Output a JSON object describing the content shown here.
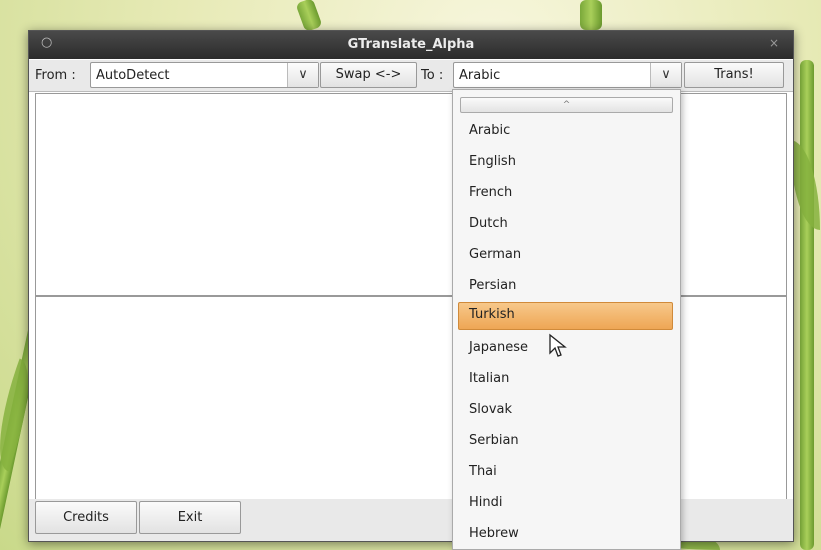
{
  "window": {
    "title": "GTranslate_Alpha",
    "close_glyph": "×",
    "menu_glyph": "○"
  },
  "toolbar": {
    "from_label": "From :",
    "from_value": "AutoDetect",
    "swap_label": "Swap <->",
    "to_label": "To :",
    "to_value": "Arabic",
    "translate_label": "Trans!",
    "arrow_glyph": "∨"
  },
  "bottom": {
    "credits_label": "Credits",
    "exit_label": "Exit"
  },
  "dropdown": {
    "scroll_up_glyph": "^",
    "options": [
      "Arabic",
      "English",
      "French",
      "Dutch",
      "German",
      "Persian",
      "Turkish",
      "Japanese",
      "Italian",
      "Slovak",
      "Serbian",
      "Thai",
      "Hindi",
      "Hebrew"
    ],
    "selected": "Turkish"
  },
  "colors": {
    "highlight": "#eea655",
    "titlebar": "#2b2b2b"
  }
}
